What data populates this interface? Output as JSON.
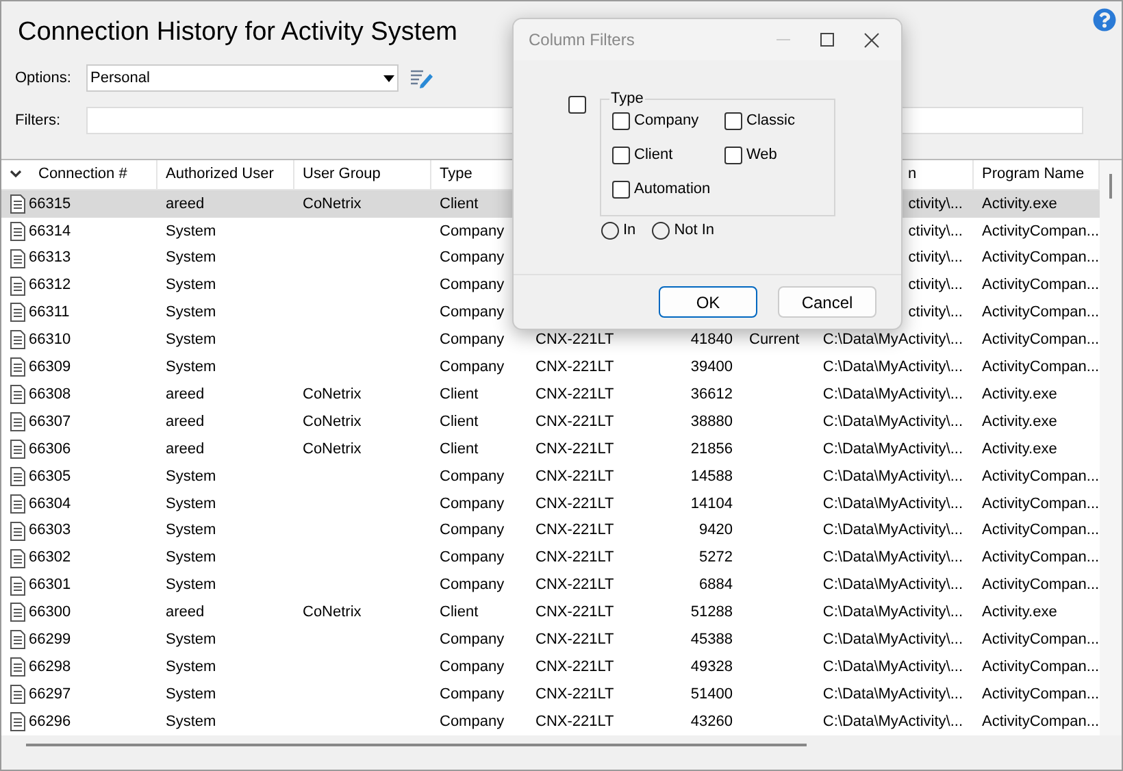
{
  "title": "Connection History for Activity System",
  "options": {
    "label": "Options:",
    "value": "Personal"
  },
  "filters": {
    "label": "Filters:"
  },
  "table": {
    "columns": [
      {
        "label": "Connection #"
      },
      {
        "label": "Authorized User"
      },
      {
        "label": "User Group"
      },
      {
        "label": "Type"
      },
      {},
      {},
      {},
      {
        "label": "n"
      },
      {
        "label": "Program Name"
      }
    ],
    "rows": [
      {
        "selected": true,
        "id": "66315",
        "user": "areed",
        "group": "CoNetrix",
        "type": "Client",
        "path": "ctivity\\...",
        "program": "Activity.exe"
      },
      {
        "selected": false,
        "id": "66314",
        "user": "System",
        "type": "Company",
        "path": "ctivity\\...",
        "program": "ActivityCompan..."
      },
      {
        "selected": false,
        "id": "66313",
        "user": "System",
        "type": "Company",
        "path": "ctivity\\...",
        "program": "ActivityCompan..."
      },
      {
        "selected": false,
        "id": "66312",
        "user": "System",
        "type": "Company",
        "path": "ctivity\\...",
        "program": "ActivityCompan..."
      },
      {
        "selected": false,
        "id": "66311",
        "user": "System",
        "type": "Company",
        "path": "ctivity\\...",
        "program": "ActivityCompan..."
      },
      {
        "selected": false,
        "id": "66310",
        "user": "System",
        "type": "Company",
        "machine": "CNX-221LT",
        "number": "41840",
        "status": "Current",
        "path": "C:\\Data\\MyActivity\\...",
        "program": "ActivityCompan..."
      },
      {
        "selected": false,
        "id": "66309",
        "user": "System",
        "type": "Company",
        "machine": "CNX-221LT",
        "number": "39400",
        "path": "C:\\Data\\MyActivity\\...",
        "program": "ActivityCompan..."
      },
      {
        "selected": false,
        "id": "66308",
        "user": "areed",
        "group": "CoNetrix",
        "type": "Client",
        "machine": "CNX-221LT",
        "number": "36612",
        "path": "C:\\Data\\MyActivity\\...",
        "program": "Activity.exe"
      },
      {
        "selected": false,
        "id": "66307",
        "user": "areed",
        "group": "CoNetrix",
        "type": "Client",
        "machine": "CNX-221LT",
        "number": "38880",
        "path": "C:\\Data\\MyActivity\\...",
        "program": "Activity.exe"
      },
      {
        "selected": false,
        "id": "66306",
        "user": "areed",
        "group": "CoNetrix",
        "type": "Client",
        "machine": "CNX-221LT",
        "number": "21856",
        "path": "C:\\Data\\MyActivity\\...",
        "program": "Activity.exe"
      },
      {
        "selected": false,
        "id": "66305",
        "user": "System",
        "type": "Company",
        "machine": "CNX-221LT",
        "number": "14588",
        "path": "C:\\Data\\MyActivity\\...",
        "program": "ActivityCompan..."
      },
      {
        "selected": false,
        "id": "66304",
        "user": "System",
        "type": "Company",
        "machine": "CNX-221LT",
        "number": "14104",
        "path": "C:\\Data\\MyActivity\\...",
        "program": "ActivityCompan..."
      },
      {
        "selected": false,
        "id": "66303",
        "user": "System",
        "type": "Company",
        "machine": "CNX-221LT",
        "number": "9420",
        "path": "C:\\Data\\MyActivity\\...",
        "program": "ActivityCompan..."
      },
      {
        "selected": false,
        "id": "66302",
        "user": "System",
        "type": "Company",
        "machine": "CNX-221LT",
        "number": "5272",
        "path": "C:\\Data\\MyActivity\\...",
        "program": "ActivityCompan..."
      },
      {
        "selected": false,
        "id": "66301",
        "user": "System",
        "type": "Company",
        "machine": "CNX-221LT",
        "number": "6884",
        "path": "C:\\Data\\MyActivity\\...",
        "program": "ActivityCompan..."
      },
      {
        "selected": false,
        "id": "66300",
        "user": "areed",
        "group": "CoNetrix",
        "type": "Client",
        "machine": "CNX-221LT",
        "number": "51288",
        "path": "C:\\Data\\MyActivity\\...",
        "program": "Activity.exe"
      },
      {
        "selected": false,
        "id": "66299",
        "user": "System",
        "type": "Company",
        "machine": "CNX-221LT",
        "number": "45388",
        "path": "C:\\Data\\MyActivity\\...",
        "program": "ActivityCompan..."
      },
      {
        "selected": false,
        "id": "66298",
        "user": "System",
        "type": "Company",
        "machine": "CNX-221LT",
        "number": "49328",
        "path": "C:\\Data\\MyActivity\\...",
        "program": "ActivityCompan..."
      },
      {
        "selected": false,
        "id": "66297",
        "user": "System",
        "type": "Company",
        "machine": "CNX-221LT",
        "number": "51400",
        "path": "C:\\Data\\MyActivity\\...",
        "program": "ActivityCompan..."
      },
      {
        "selected": false,
        "id": "66296",
        "user": "System",
        "type": "Company",
        "machine": "CNX-221LT",
        "number": "43260",
        "path": "C:\\Data\\MyActivity\\...",
        "program": "ActivityCompan..."
      }
    ]
  },
  "dialog": {
    "title": "Column Filters",
    "all_checked": false,
    "group_title": "Type",
    "options": [
      {
        "label": "Company",
        "checked": false
      },
      {
        "label": "Classic",
        "checked": false
      },
      {
        "label": "Client",
        "checked": false
      },
      {
        "label": "Web",
        "checked": false
      },
      {
        "label": "Automation",
        "checked": false
      }
    ],
    "modes": [
      {
        "label": "In",
        "selected": false
      },
      {
        "label": "Not In",
        "selected": false
      }
    ],
    "buttons": [
      {
        "label": "OK",
        "kind": "primary"
      },
      {
        "label": "Cancel",
        "kind": "secondary"
      }
    ]
  }
}
